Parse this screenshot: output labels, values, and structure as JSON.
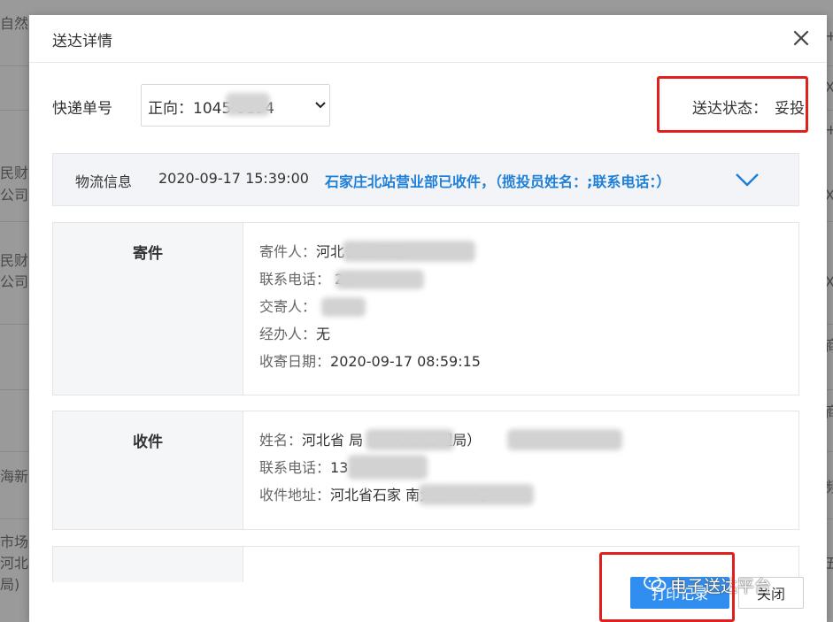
{
  "background": {
    "left_cells": [
      "自然资",
      "民财产",
      "公司虎",
      "民财产",
      "公司虎",
      "海新区",
      "市场监",
      "河北省",
      "局)"
    ],
    "right_cells": [
      "+",
      "X",
      "+",
      "X",
      "X",
      "商",
      "商",
      "频",
      "五"
    ]
  },
  "modal": {
    "title": "送达详情",
    "close_icon": "close-icon"
  },
  "tracking": {
    "label": "快递单号",
    "select_value": "正向：1045      8194",
    "status_label": "送达状态：",
    "status_value": "妥投"
  },
  "logistics": {
    "label": "物流信息",
    "time": "2020-09-17 15:39:00",
    "description": "石家庄北站营业部已收件，（揽投员姓名：;联系电话：）"
  },
  "sender": {
    "title": "寄件",
    "rows": [
      {
        "key": "寄件人：",
        "value": "河北省              立案庭"
      },
      {
        "key": "联系电话：",
        "value": "              24"
      },
      {
        "key": "交寄人：",
        "value": "     "
      },
      {
        "key": "经办人：",
        "value": "无"
      },
      {
        "key": "收寄日期：",
        "value": "2020-09-17 08:59:15"
      }
    ]
  },
  "receiver": {
    "title": "收件",
    "rows": [
      {
        "key": "姓名：",
        "value": "河北省          局（原河北          管理局）"
      },
      {
        "key": "联系电话：",
        "value": "13"
      },
      {
        "key": "收件地址：",
        "value": "河北省石家             南大街537号"
      }
    ]
  },
  "footer": {
    "print_label": "打印记录",
    "close_label": "关闭"
  },
  "watermark": {
    "text": "电子送达平台"
  },
  "colors": {
    "accent": "#2f8ef0",
    "link_blue": "#1e7fd8",
    "highlight_red": "#e0201f"
  }
}
